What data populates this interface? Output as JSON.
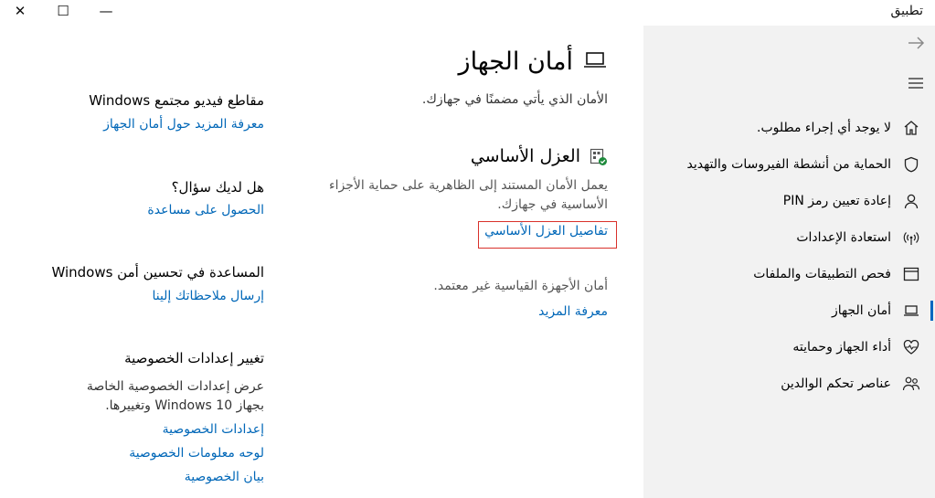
{
  "window": {
    "title": "تطبيق",
    "close_glyph": "✕",
    "maximize_glyph": "☐",
    "minimize_glyph": "—"
  },
  "sidebar": {
    "items": [
      {
        "label": "لا يوجد أي إجراء مطلوب.",
        "icon": "home-icon"
      },
      {
        "label": "الحماية من أنشطة الفيروسات والتهديد",
        "icon": "shield-icon"
      },
      {
        "label": "إعادة تعيين رمز PIN",
        "icon": "person-icon"
      },
      {
        "label": "استعادة الإعدادات",
        "icon": "wireless-icon"
      },
      {
        "label": "فحص التطبيقات والملفات",
        "icon": "browser-window-icon"
      },
      {
        "label": "أمان الجهاز",
        "icon": "laptop-icon",
        "active": true
      },
      {
        "label": "أداء الجهاز وحمايته",
        "icon": "heart-icon"
      },
      {
        "label": "عناصر تحكم الوالدين",
        "icon": "family-icon"
      }
    ]
  },
  "main": {
    "title": "أمان الجهاز",
    "subtitle": "الأمان الذي يأتي مضمنًا في جهازك.",
    "core_isolation": {
      "title": "العزل الأساسي",
      "description_line1": "يعمل الأمان المستند إلى الظاهرية على حماية الأجزاء",
      "description_line2": "الأساسية في جهازك.",
      "link": "تفاصيل العزل الأساسي"
    },
    "hardware_note": "أمان الأجهزة القياسية غير معتمد.",
    "learn_more": "معرفة المزيد"
  },
  "aside": {
    "videos": {
      "title": "مقاطع فيديو مجتمع Windows",
      "link": "معرفة المزيد حول أمان الجهاز"
    },
    "question": {
      "title": "هل لديك سؤال؟",
      "link": "الحصول على مساعدة"
    },
    "improve": {
      "title": "المساعدة في تحسين أمن Windows",
      "link": "إرسال ملاحظاتك إلينا"
    },
    "privacy": {
      "title": "تغيير إعدادات الخصوصية",
      "description_line1": "عرض إعدادات الخصوصية الخاصة",
      "description_line2": "بجهاز Windows 10 وتغييرها.",
      "links": [
        "إعدادات الخصوصية",
        "لوحه معلومات الخصوصية",
        "بيان الخصوصية"
      ]
    }
  }
}
